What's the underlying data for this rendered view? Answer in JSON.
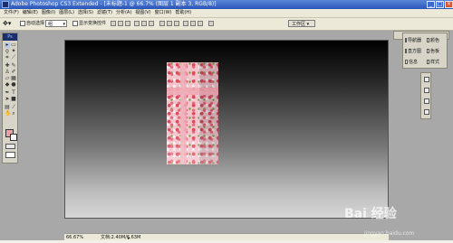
{
  "window": {
    "title": "Adobe Photoshop CS3 Extended - [未标题-1 @ 66.7% (图层 1 副本 3, RGB/8)]",
    "buttons": [
      "_",
      "□",
      "×"
    ]
  },
  "menu": {
    "items": [
      "文件(F)",
      "编辑(E)",
      "图像(I)",
      "图层(L)",
      "选择(S)",
      "滤镜(T)",
      "分析(A)",
      "视图(V)",
      "窗口(W)",
      "帮助(H)"
    ]
  },
  "options": {
    "auto_select_label": "自动选择",
    "layer_dropdown": "组",
    "show_transform_label": "显示变换控件",
    "workspace_label": "工作区 ▾"
  },
  "toolbox": {
    "header": "Ps",
    "tools": [
      "move-tool",
      "marquee-tool",
      "lasso-tool",
      "magic-wand-tool",
      "crop-tool",
      "slice-tool",
      "healing-tool",
      "brush-tool",
      "stamp-tool",
      "history-brush-tool",
      "eraser-tool",
      "gradient-tool",
      "blur-tool",
      "dodge-tool",
      "pen-tool",
      "type-tool",
      "path-select-tool",
      "shape-tool",
      "notes-tool",
      "eyedropper-tool",
      "hand-tool",
      "zoom-tool"
    ],
    "fg_color": "#e8a3a6",
    "bg_color": "#ffffff"
  },
  "panels": {
    "group1": [
      {
        "label": "导航器",
        "icon": "navigator-icon"
      },
      {
        "label": "直方图",
        "icon": "histogram-icon"
      },
      {
        "label": "信息",
        "icon": "info-icon"
      }
    ],
    "group2": [
      {
        "label": "颜色",
        "icon": "color-icon"
      },
      {
        "label": "色板",
        "icon": "swatches-icon"
      },
      {
        "label": "样式",
        "icon": "styles-icon"
      }
    ]
  },
  "status": {
    "zoom": "66.67%",
    "doc": "文档:2.40M/6.63M"
  },
  "watermark": {
    "main": "Bai 经验",
    "sub": "jingyan.baidu.com"
  }
}
